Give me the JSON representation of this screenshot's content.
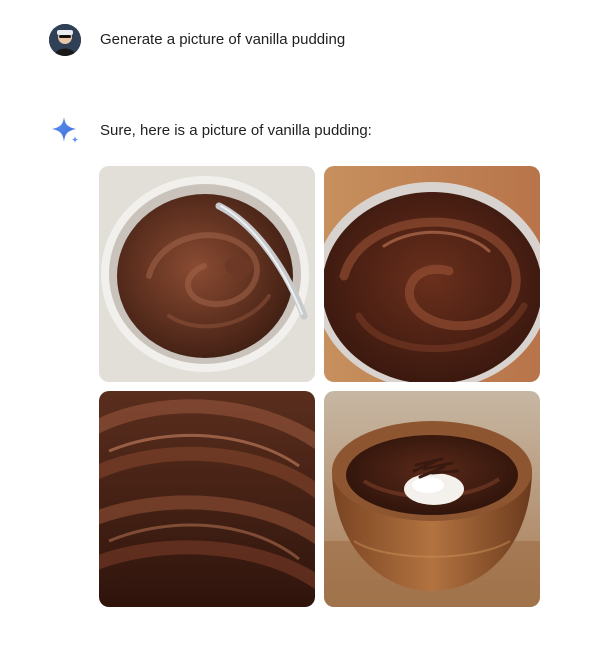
{
  "prompt": {
    "text": "Generate a picture of vanilla pudding",
    "avatar_icon": "user-avatar-icon"
  },
  "response": {
    "icon": "sparkle-icon",
    "text": "Sure, here is a picture of vanilla pudding:",
    "images": [
      {
        "name": "pudding-image-1",
        "subject": "chocolate pudding in white bowl with spoon"
      },
      {
        "name": "pudding-image-2",
        "subject": "swirled chocolate pudding in bowl"
      },
      {
        "name": "pudding-image-3",
        "subject": "close-up chocolate pudding swirl"
      },
      {
        "name": "pudding-image-4",
        "subject": "chocolate pudding in wooden bowl with cream and shavings"
      }
    ]
  },
  "colors": {
    "accent": "#4b8cf5",
    "text": "#1f1f1f",
    "pudding_dark": "#3b1f14",
    "pudding_mid": "#6b3a26"
  }
}
